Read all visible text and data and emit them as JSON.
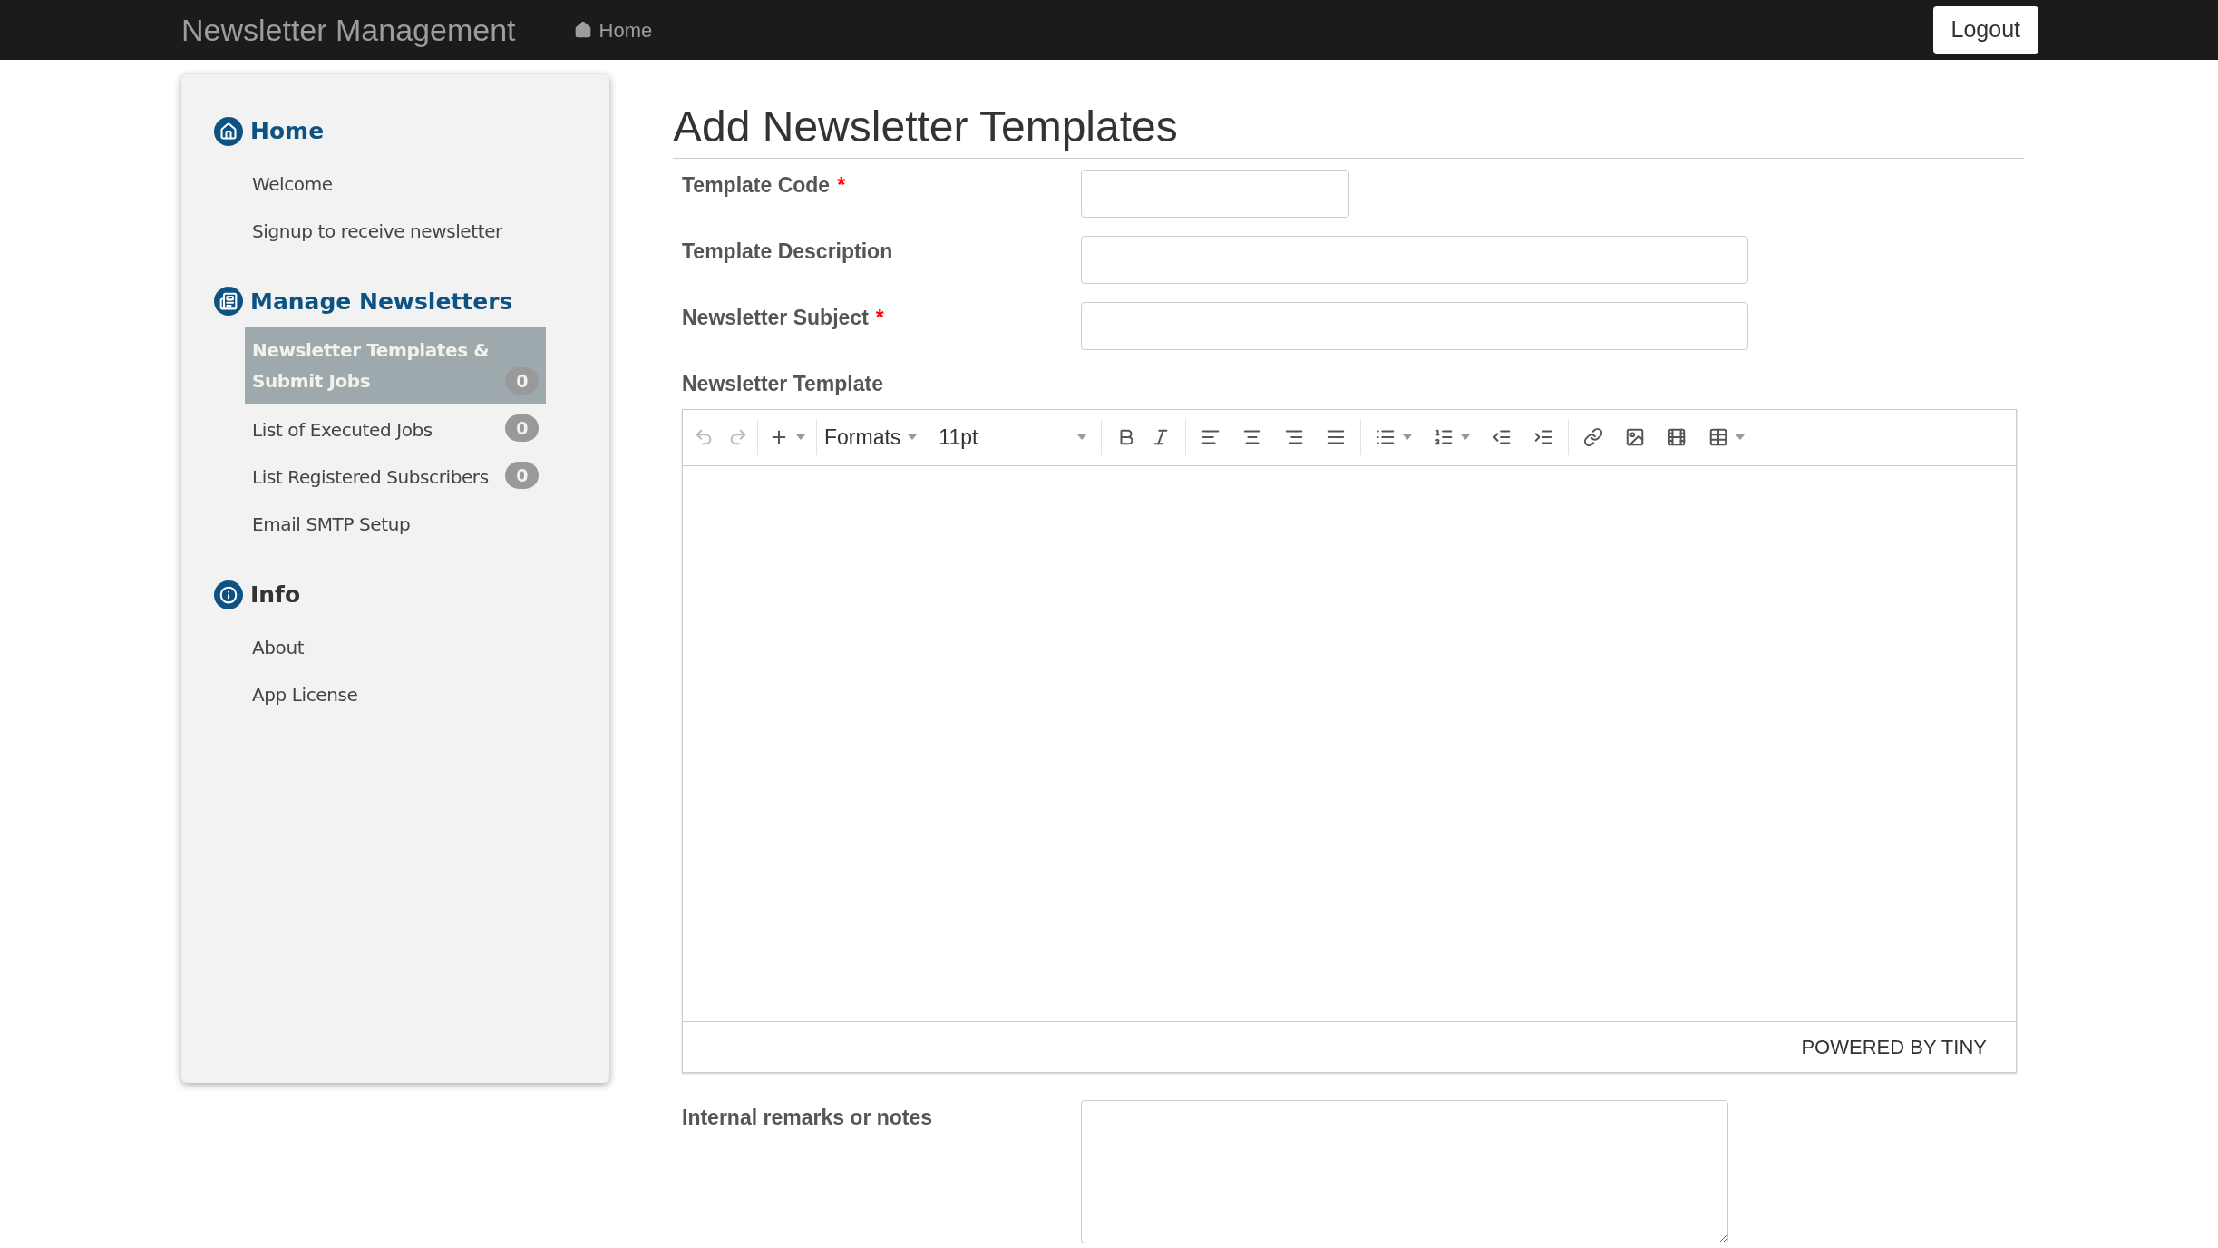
{
  "navbar": {
    "brand": "Newsletter Management",
    "links": [
      {
        "label": "Home"
      }
    ],
    "logout": "Logout"
  },
  "sidebar": {
    "sections": [
      {
        "kind": "home",
        "title": "Home",
        "items": [
          {
            "label": "Welcome",
            "selected": false
          },
          {
            "label": "Signup to receive newsletter",
            "selected": false
          }
        ]
      },
      {
        "kind": "manage",
        "title": "Manage Newsletters",
        "items": [
          {
            "label": "Newsletter Templates & Submit Jobs",
            "selected": true,
            "badge": "0"
          },
          {
            "label": "List of Executed Jobs",
            "selected": false,
            "badge": "0"
          },
          {
            "label": "List Registered Subscribers",
            "selected": false,
            "badge": "0"
          },
          {
            "label": "Email SMTP Setup",
            "selected": false
          }
        ]
      },
      {
        "kind": "info",
        "title": "Info",
        "items": [
          {
            "label": "About",
            "selected": false
          },
          {
            "label": "App License",
            "selected": false
          }
        ]
      }
    ]
  },
  "page": {
    "title": "Add Newsletter Templates",
    "fields": [
      {
        "kind": "short",
        "label": "Template Code",
        "required_mark": "*"
      },
      {
        "kind": "wide",
        "label": "Template Description"
      },
      {
        "kind": "wide",
        "label": "Newsletter Subject",
        "required_mark": "*"
      }
    ],
    "editor": {
      "label": "Newsletter Template",
      "undo_disabled": true,
      "redo_disabled": true,
      "formats": "Formats",
      "font_size": "11pt",
      "footer": "POWERED BY TINY"
    },
    "remarks": {
      "label": "Internal remarks or notes"
    }
  }
}
